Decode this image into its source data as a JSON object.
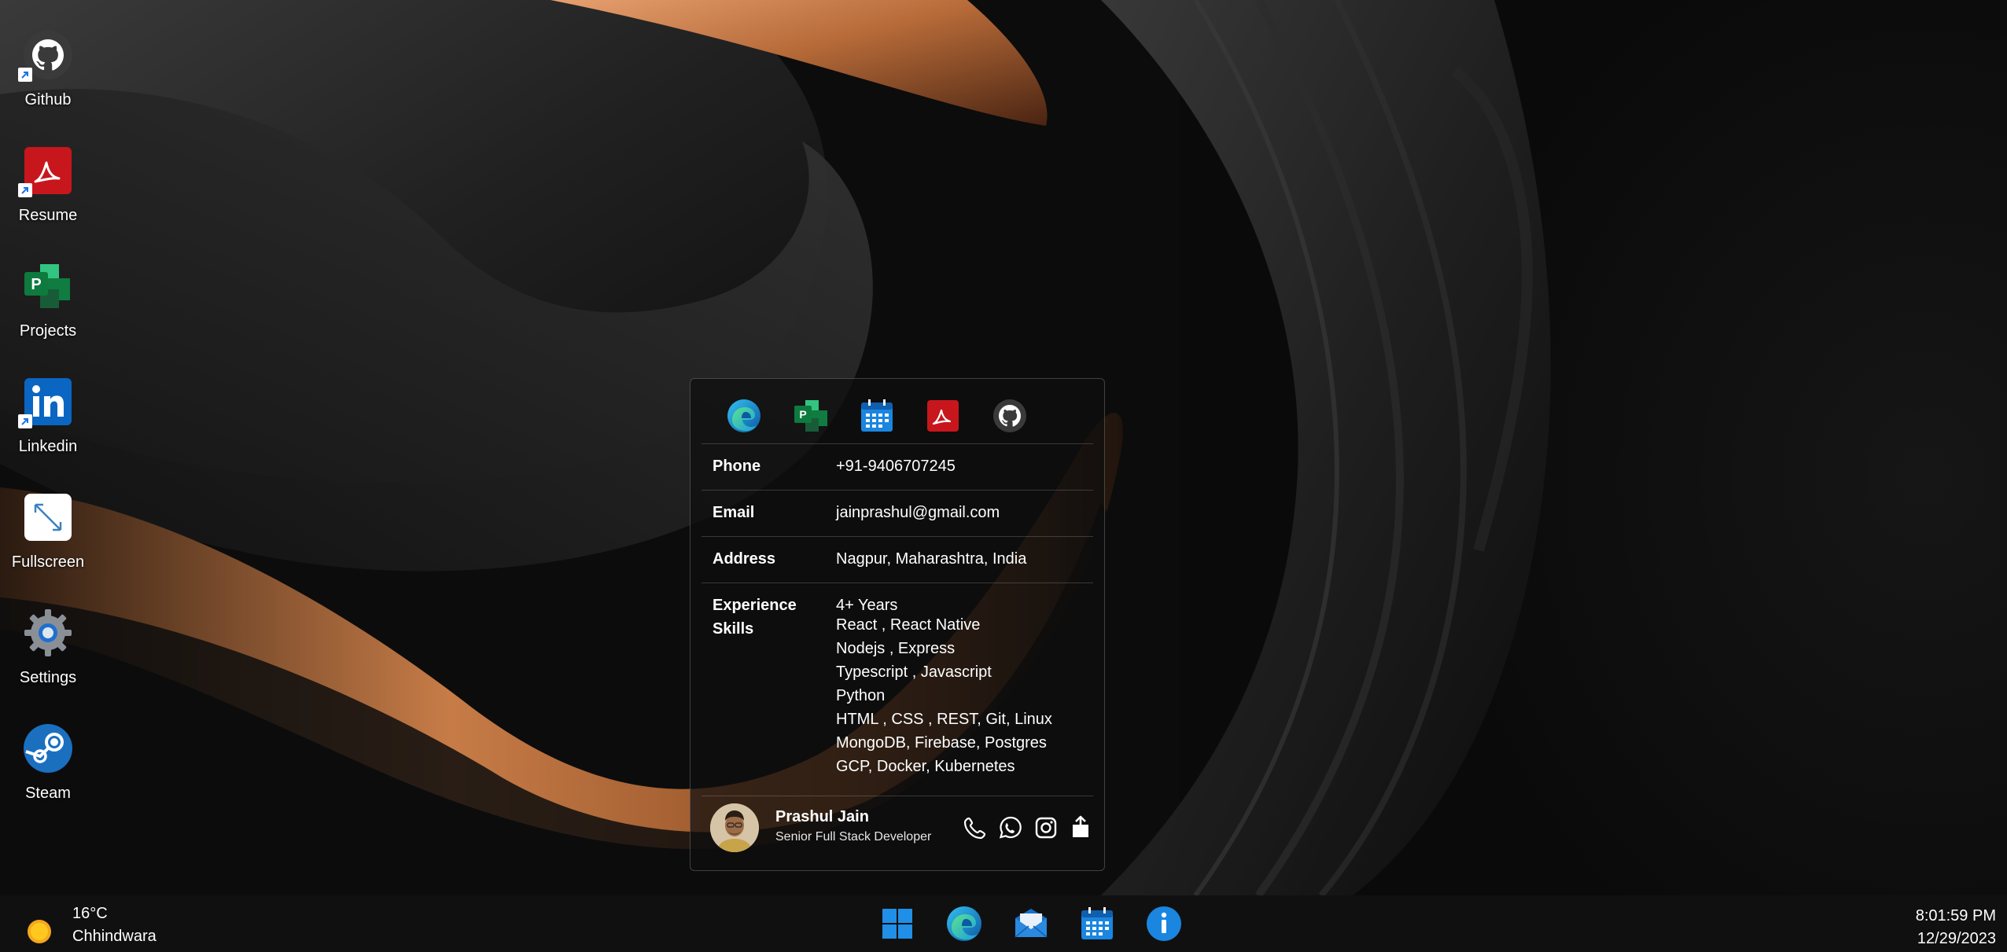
{
  "desktop": {
    "icons": [
      {
        "label": "Github",
        "icon": "github-icon"
      },
      {
        "label": "Resume",
        "icon": "pdf-icon"
      },
      {
        "label": "Projects",
        "icon": "project-icon"
      },
      {
        "label": "Linkedin",
        "icon": "linkedin-icon"
      },
      {
        "label": "Fullscreen",
        "icon": "fullscreen-icon"
      },
      {
        "label": "Settings",
        "icon": "gear-icon"
      },
      {
        "label": "Steam",
        "icon": "steam-icon"
      }
    ]
  },
  "card": {
    "apps": [
      {
        "icon": "edge-icon"
      },
      {
        "icon": "project-icon"
      },
      {
        "icon": "calendar-icon"
      },
      {
        "icon": "pdf-icon"
      },
      {
        "icon": "github-icon"
      }
    ],
    "rows": {
      "phone": {
        "key": "Phone",
        "value": "+91-9406707245"
      },
      "email": {
        "key": "Email",
        "value": "jainprashul@gmail.com"
      },
      "address": {
        "key": "Address",
        "value": "Nagpur, Maharashtra, India"
      },
      "experience": {
        "key": "Experience",
        "value": "4+ Years"
      },
      "skills": {
        "key": "Skills",
        "items": [
          "React , React Native",
          "Nodejs , Express",
          "Typescript , Javascript",
          "Python",
          "HTML , CSS , REST, Git, Linux",
          "MongoDB, Firebase, Postgres",
          "GCP, Docker, Kubernetes"
        ]
      }
    },
    "profile": {
      "name": "Prashul Jain",
      "title": "Senior Full Stack Developer",
      "actions": [
        "phone-icon",
        "whatsapp-icon",
        "instagram-icon",
        "share-icon"
      ]
    }
  },
  "taskbar": {
    "weather": {
      "temp": "16°C",
      "city": "Chhindwara",
      "icon": "sun-icon"
    },
    "apps": [
      "windows-start-icon",
      "edge-icon",
      "mail-icon",
      "calendar-icon",
      "info-icon"
    ],
    "clock": {
      "time": "8:01:59 PM",
      "date": "12/29/2023"
    }
  },
  "colors": {
    "accent_blue": "#0078d4",
    "pdf_red": "#c8161d",
    "project_green": "#107c41",
    "wallpaper_copper": "#c87a45"
  }
}
